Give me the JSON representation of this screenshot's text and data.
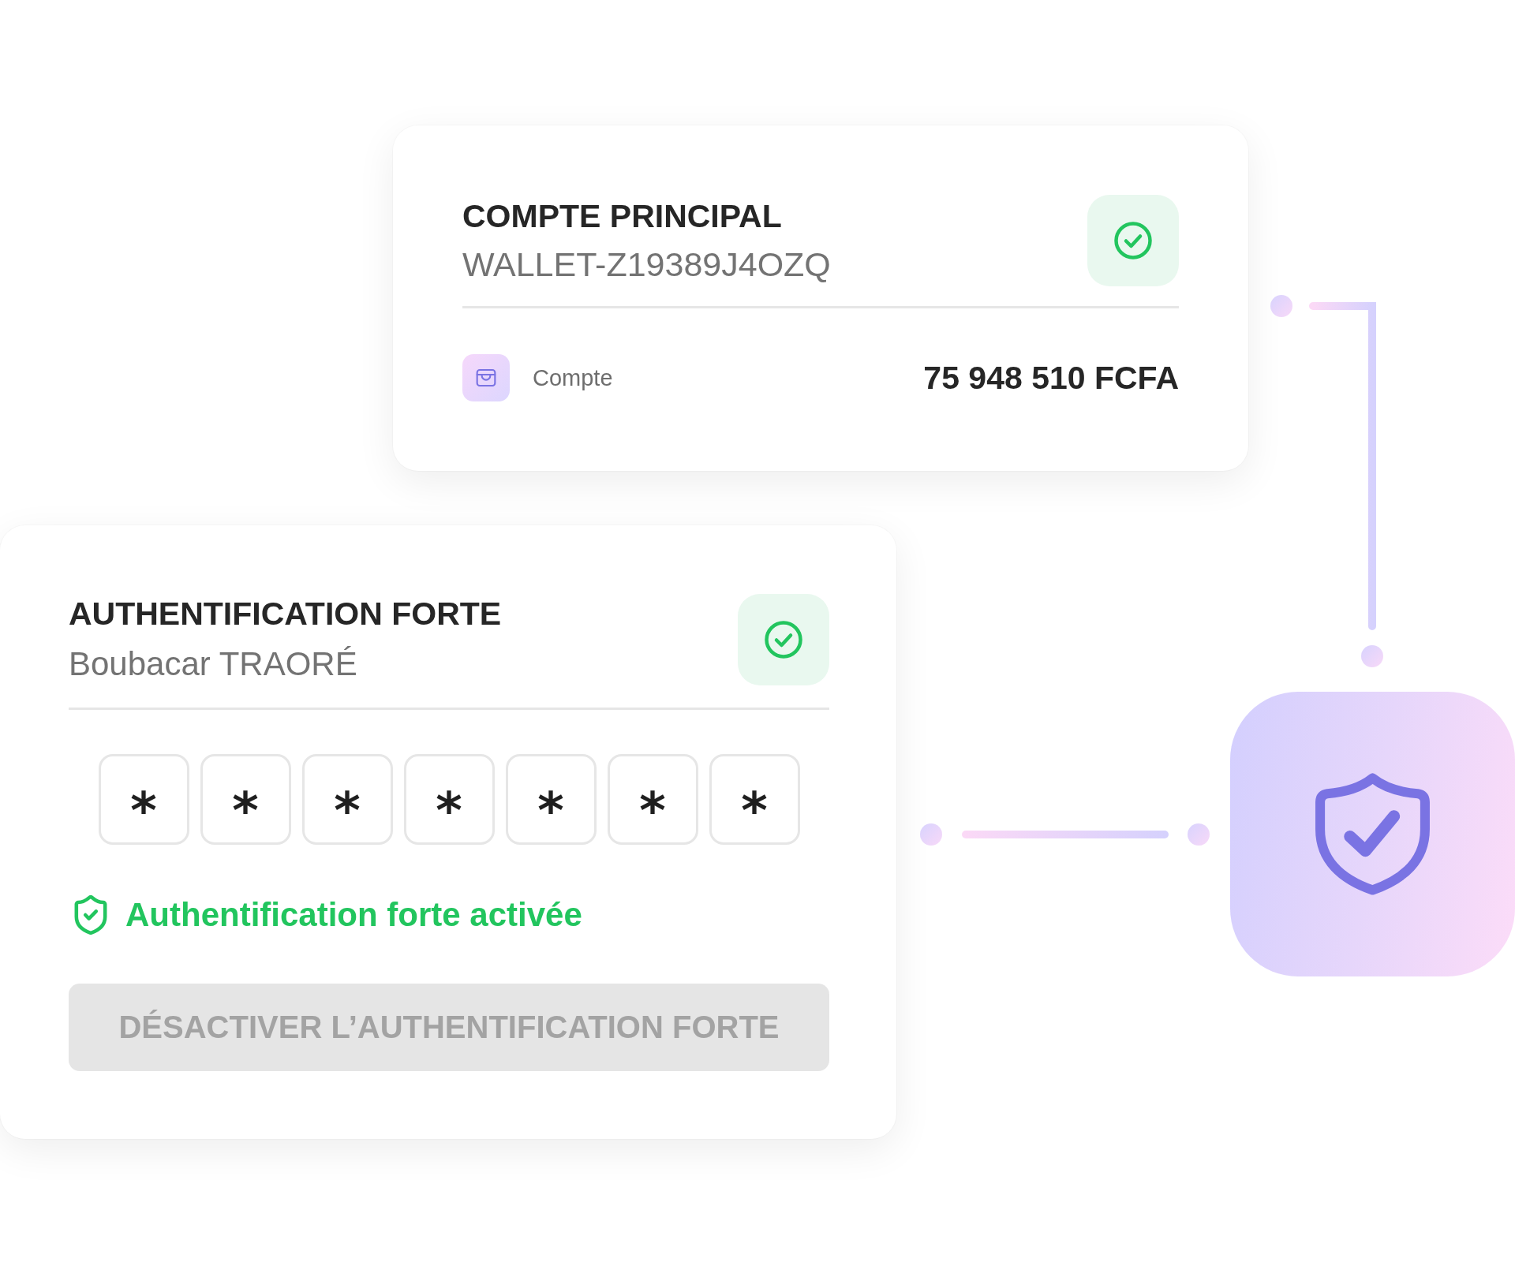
{
  "account_card": {
    "title": "COMPTE PRINCIPAL",
    "wallet_id": "WALLET-Z19389J4OZQ",
    "verified": true,
    "label": "Compte",
    "balance": "75 948 510 FCFA"
  },
  "auth_card": {
    "title": "AUTHENTIFICATION FORTE",
    "user_name": "Boubacar TRAORÉ",
    "verified": true,
    "pin_digits": [
      "*",
      "*",
      "*",
      "*",
      "*",
      "*",
      "*"
    ],
    "status": "Authentification forte activée",
    "button": {
      "label": "DÉSACTIVER L’AUTHENTIFICATION FORTE",
      "disabled": true
    }
  }
}
